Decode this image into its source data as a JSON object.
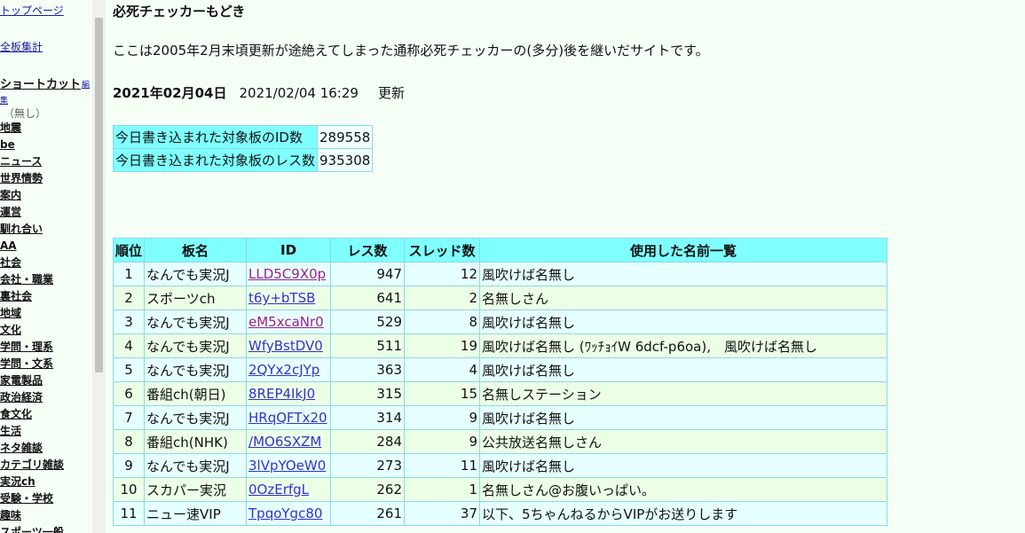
{
  "sidebar": {
    "top_page": "トップページ",
    "all_boards": "全板集計",
    "shortcut": "ショートカット",
    "shortcut_edit_1": "編",
    "shortcut_edit_2": "集",
    "none": "（無し）",
    "boards": [
      "地震",
      "be",
      "ニュース",
      "世界情勢",
      "案内",
      "運営",
      "馴れ合い",
      "AA",
      "社会",
      "会社・職業",
      "裏社会",
      "地域",
      "文化",
      "学問・理系",
      "学問・文系",
      "家電製品",
      "政治経済",
      "食文化",
      "生活",
      "ネタ雑談",
      "カテゴリ雑談",
      "実況ch",
      "受験・学校",
      "趣味",
      "スポーツ一般"
    ]
  },
  "header": {
    "title": "必死チェッカーもどき",
    "intro": "ここは2005年2月末頃更新が途絶えてしまった通称必死チェッカーの(多分)後を継いだサイトです。",
    "date": "2021年02月04日",
    "updated_time": "2021/02/04 16:29",
    "updated_label": "更新"
  },
  "stats": {
    "id_count_label": "今日書き込まれた対象板のID数",
    "id_count": "289558",
    "res_count_label": "今日書き込まれた対象板のレス数",
    "res_count": "935308"
  },
  "ranking": {
    "headers": [
      "順位",
      "板名",
      "ID",
      "レス数",
      "スレッド数",
      "使用した名前一覧"
    ],
    "rows": [
      {
        "rank": "1",
        "board": "なんでも実況J",
        "id": "LLD5C9X0p",
        "res": "947",
        "threads": "12",
        "names": "風吹けば名無し",
        "visited": true
      },
      {
        "rank": "2",
        "board": "スポーツch",
        "id": "t6y+bTSB",
        "res": "641",
        "threads": "2",
        "names": "名無しさん",
        "visited": false
      },
      {
        "rank": "3",
        "board": "なんでも実況J",
        "id": "eM5xcaNr0",
        "res": "529",
        "threads": "8",
        "names": "風吹けば名無し",
        "visited": true
      },
      {
        "rank": "4",
        "board": "なんでも実況J",
        "id": "WfyBstDV0",
        "res": "511",
        "threads": "19",
        "names": "風吹けば名無し (ﾜｯﾁｮｲW 6dcf-p6oa),　風吹けば名無し",
        "visited": false
      },
      {
        "rank": "5",
        "board": "なんでも実況J",
        "id": "2QYx2cJYp",
        "res": "363",
        "threads": "4",
        "names": "風吹けば名無し",
        "visited": false
      },
      {
        "rank": "6",
        "board": "番組ch(朝日)",
        "id": "8REP4IkJ0",
        "res": "315",
        "threads": "15",
        "names": "名無しステーション",
        "visited": false
      },
      {
        "rank": "7",
        "board": "なんでも実況J",
        "id": "HRqQFTx20",
        "res": "314",
        "threads": "9",
        "names": "風吹けば名無し",
        "visited": false
      },
      {
        "rank": "8",
        "board": "番組ch(NHK)",
        "id": "/MO6SXZM",
        "res": "284",
        "threads": "9",
        "names": "公共放送名無しさん",
        "visited": false
      },
      {
        "rank": "9",
        "board": "なんでも実況J",
        "id": "3lVpYOeW0",
        "res": "273",
        "threads": "11",
        "names": "風吹けば名無し",
        "visited": false
      },
      {
        "rank": "10",
        "board": "スカパー実況",
        "id": "0OzErfgL",
        "res": "262",
        "threads": "1",
        "names": "名無しさん@お腹いっぱい。",
        "visited": false
      },
      {
        "rank": "11",
        "board": "ニュー速VIP",
        "id": "TpqoYgc80",
        "res": "261",
        "threads": "37",
        "names": "以下、5ちゃんねるからVIPがお送りします",
        "visited": false
      }
    ]
  },
  "colors": {
    "header_bg": "#80ffff",
    "row_odd": "#e6ffff",
    "row_even": "#ecffe6",
    "page_bg": "#f5fff5"
  }
}
